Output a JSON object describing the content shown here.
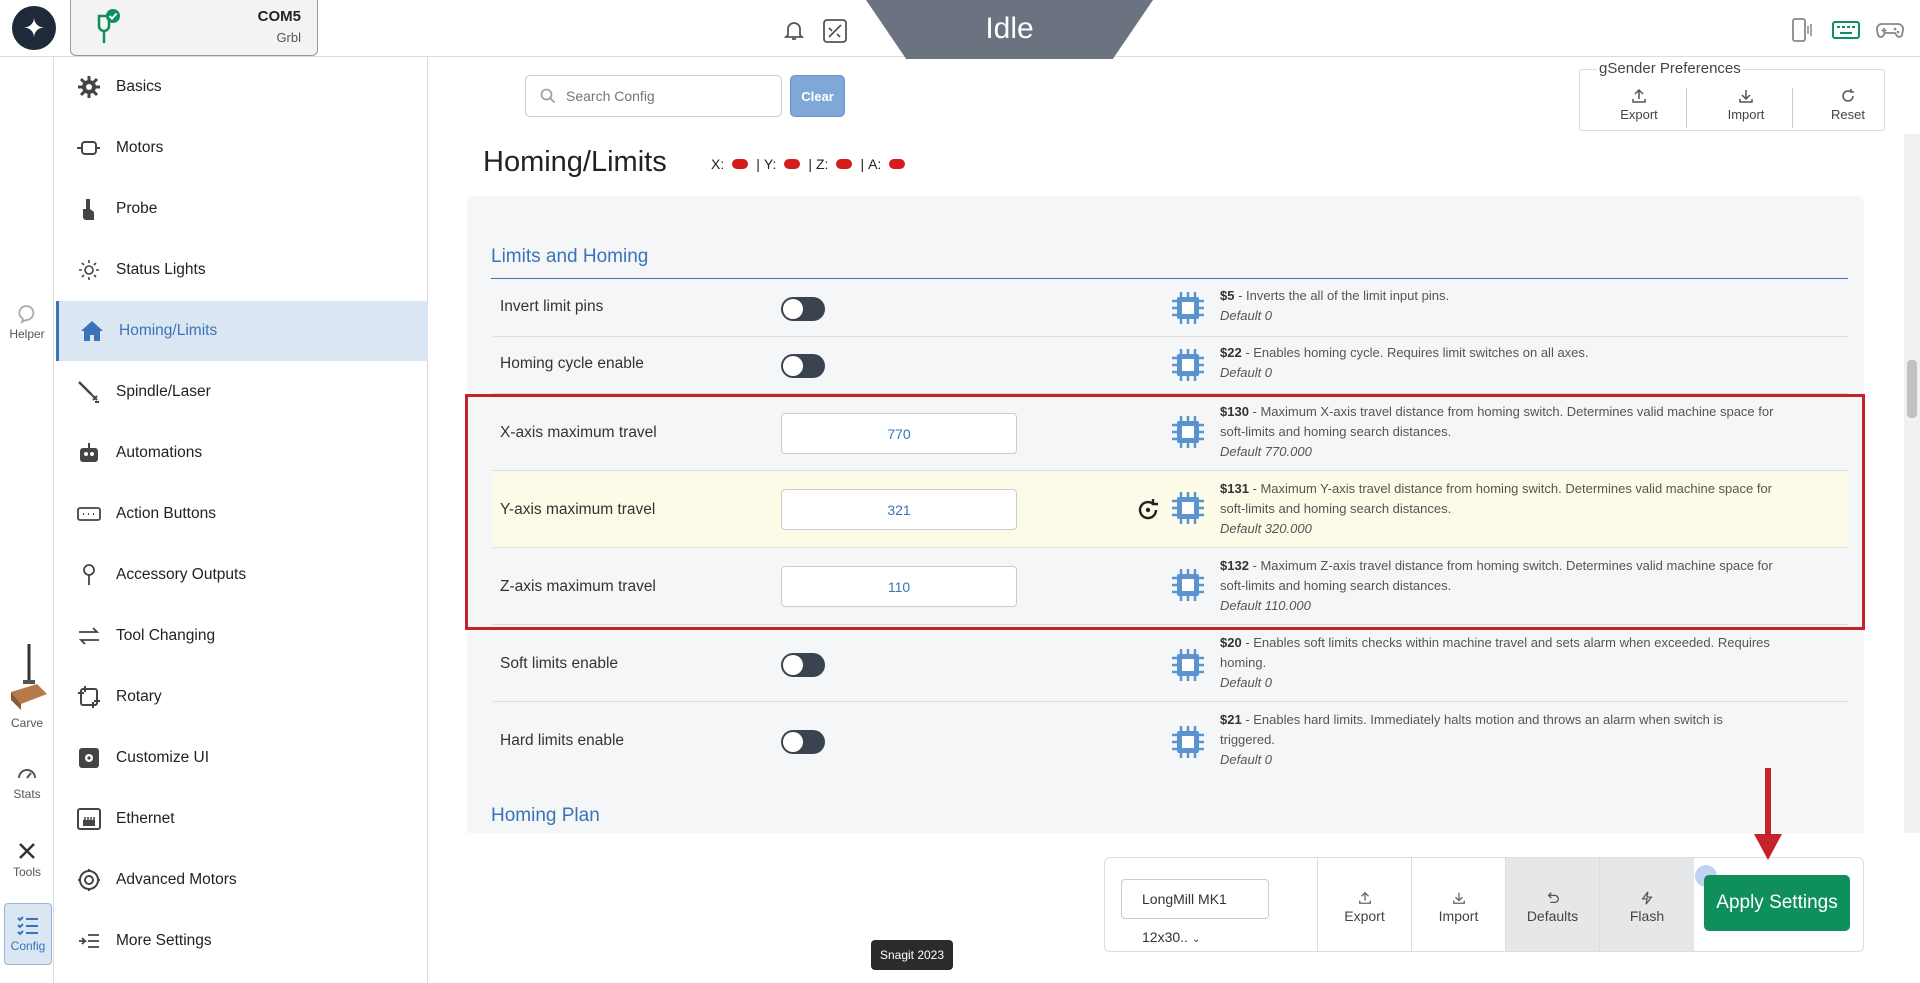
{
  "topbar": {
    "port": "COM5",
    "firmware": "Grbl",
    "machine_state": "Idle"
  },
  "rail": {
    "helper": "Helper",
    "carve": "Carve",
    "stats": "Stats",
    "tools": "Tools",
    "config": "Config"
  },
  "nav": {
    "items": [
      {
        "label": "Basics",
        "icon": "gear-icon"
      },
      {
        "label": "Motors",
        "icon": "motor-icon"
      },
      {
        "label": "Probe",
        "icon": "probe-icon"
      },
      {
        "label": "Status Lights",
        "icon": "sun-icon"
      },
      {
        "label": "Homing/Limits",
        "icon": "home-icon"
      },
      {
        "label": "Spindle/Laser",
        "icon": "spindle-icon"
      },
      {
        "label": "Automations",
        "icon": "robot-icon"
      },
      {
        "label": "Action Buttons",
        "icon": "buttons-icon"
      },
      {
        "label": "Accessory Outputs",
        "icon": "pin-icon"
      },
      {
        "label": "Tool Changing",
        "icon": "swap-icon"
      },
      {
        "label": "Rotary",
        "icon": "rotary-icon"
      },
      {
        "label": "Customize UI",
        "icon": "customize-icon"
      },
      {
        "label": "Ethernet",
        "icon": "ethernet-icon"
      },
      {
        "label": "Advanced Motors",
        "icon": "advanced-motor-icon"
      },
      {
        "label": "More Settings",
        "icon": "more-icon"
      }
    ],
    "active_index": 4
  },
  "search": {
    "placeholder": "Search Config",
    "clear_label": "Clear"
  },
  "prefs": {
    "title": "gSender Preferences",
    "export": "Export",
    "import": "Import",
    "reset": "Reset"
  },
  "page": {
    "title": "Homing/Limits",
    "axes": [
      {
        "label": "X:",
        "state": "red"
      },
      {
        "label": "Y:",
        "state": "red"
      },
      {
        "label": "Z:",
        "state": "red"
      },
      {
        "label": "A:",
        "state": "red"
      }
    ],
    "separator": "|",
    "section1": "Limits and Homing",
    "section2": "Homing Plan"
  },
  "settings": [
    {
      "label": "Invert limit pins",
      "type": "toggle",
      "on": false,
      "code": "$5",
      "desc": " - Inverts the all of the limit input pins.",
      "default": "Default 0"
    },
    {
      "label": "Homing cycle enable",
      "type": "toggle",
      "on": false,
      "code": "$22",
      "desc": " - Enables homing cycle. Requires limit switches on all axes.",
      "default": "Default 0"
    },
    {
      "label": "X-axis maximum travel",
      "type": "number",
      "value": "770",
      "code": "$130",
      "desc": " - Maximum X-axis travel distance from homing switch. Determines valid machine space for soft-limits and homing search distances.",
      "default": "Default 770.000"
    },
    {
      "label": "Y-axis maximum travel",
      "type": "number",
      "value": "321",
      "code": "$131",
      "desc": " - Maximum Y-axis travel distance from homing switch. Determines valid machine space for soft-limits and homing search distances.",
      "default": "Default 320.000",
      "modified": true
    },
    {
      "label": "Z-axis maximum travel",
      "type": "number",
      "value": "110",
      "code": "$132",
      "desc": " - Maximum Z-axis travel distance from homing switch. Determines valid machine space for soft-limits and homing search distances.",
      "default": "Default 110.000"
    },
    {
      "label": "Soft limits enable",
      "type": "toggle",
      "on": false,
      "code": "$20",
      "desc": " - Enables soft limits checks within machine travel and sets alarm when exceeded. Requires homing.",
      "default": "Default 0"
    },
    {
      "label": "Hard limits enable",
      "type": "toggle",
      "on": false,
      "code": "$21",
      "desc": " - Enables hard limits. Immediately halts motion and throws an alarm when switch is triggered.",
      "default": "Default 0"
    }
  ],
  "actionbar": {
    "profile": "LongMill MK1 12x30..",
    "export": "Export",
    "import": "Import",
    "defaults": "Defaults",
    "flash": "Flash",
    "apply": "Apply Settings"
  },
  "tooltip": "Snagit 2023",
  "colors": {
    "accent": "#3a74b8",
    "apply": "#0f8f5c",
    "modified_row": "#fbfbe8",
    "highlight_box": "#c4232b",
    "axis_dot": "#d61b1b"
  }
}
